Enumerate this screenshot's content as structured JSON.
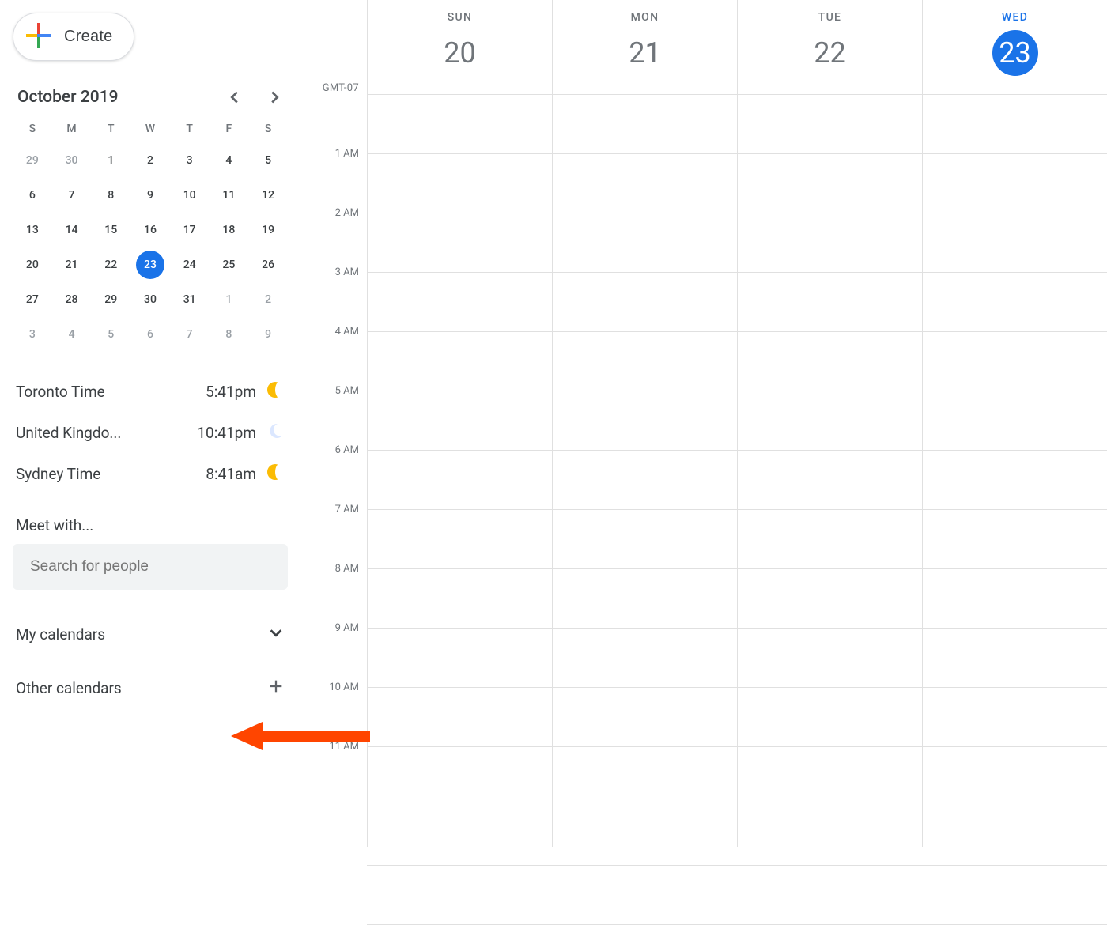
{
  "create_button_label": "Create",
  "minical": {
    "title": "October 2019",
    "dow": [
      "S",
      "M",
      "T",
      "W",
      "T",
      "F",
      "S"
    ],
    "weeks": [
      [
        {
          "d": "29",
          "off": true
        },
        {
          "d": "30",
          "off": true
        },
        {
          "d": "1"
        },
        {
          "d": "2"
        },
        {
          "d": "3"
        },
        {
          "d": "4"
        },
        {
          "d": "5"
        }
      ],
      [
        {
          "d": "6"
        },
        {
          "d": "7"
        },
        {
          "d": "8"
        },
        {
          "d": "9"
        },
        {
          "d": "10"
        },
        {
          "d": "11"
        },
        {
          "d": "12"
        }
      ],
      [
        {
          "d": "13"
        },
        {
          "d": "14"
        },
        {
          "d": "15"
        },
        {
          "d": "16"
        },
        {
          "d": "17"
        },
        {
          "d": "18"
        },
        {
          "d": "19"
        }
      ],
      [
        {
          "d": "20"
        },
        {
          "d": "21"
        },
        {
          "d": "22"
        },
        {
          "d": "23",
          "today": true
        },
        {
          "d": "24"
        },
        {
          "d": "25"
        },
        {
          "d": "26"
        }
      ],
      [
        {
          "d": "27"
        },
        {
          "d": "28"
        },
        {
          "d": "29"
        },
        {
          "d": "30"
        },
        {
          "d": "31"
        },
        {
          "d": "1",
          "off": true
        },
        {
          "d": "2",
          "off": true
        }
      ],
      [
        {
          "d": "3",
          "off": true
        },
        {
          "d": "4",
          "off": true
        },
        {
          "d": "5",
          "off": true
        },
        {
          "d": "6",
          "off": true
        },
        {
          "d": "7",
          "off": true
        },
        {
          "d": "8",
          "off": true
        },
        {
          "d": "9",
          "off": true
        }
      ]
    ]
  },
  "clocks": [
    {
      "name": "Toronto Time",
      "time": "5:41pm",
      "icon": "sun"
    },
    {
      "name": "United Kingdo...",
      "time": "10:41pm",
      "icon": "moon"
    },
    {
      "name": "Sydney Time",
      "time": "8:41am",
      "icon": "sun"
    }
  ],
  "meet_with_label": "Meet with...",
  "search_placeholder": "Search for people",
  "my_calendars_label": "My calendars",
  "other_calendars_label": "Other calendars",
  "timezone_label": "GMT-07",
  "hours": [
    "1 AM",
    "2 AM",
    "3 AM",
    "4 AM",
    "5 AM",
    "6 AM",
    "7 AM",
    "8 AM",
    "9 AM",
    "10 AM",
    "11 AM"
  ],
  "days": [
    {
      "dow": "SUN",
      "num": "20",
      "today": false
    },
    {
      "dow": "MON",
      "num": "21",
      "today": false
    },
    {
      "dow": "TUE",
      "num": "22",
      "today": false
    },
    {
      "dow": "WED",
      "num": "23",
      "today": true
    }
  ],
  "colors": {
    "primary": "#1a73e8",
    "google_blue": "#4285f4",
    "google_red": "#ea4335",
    "google_yellow": "#fbbc04",
    "google_green": "#34a853",
    "annotation_orange": "#ff4500"
  }
}
